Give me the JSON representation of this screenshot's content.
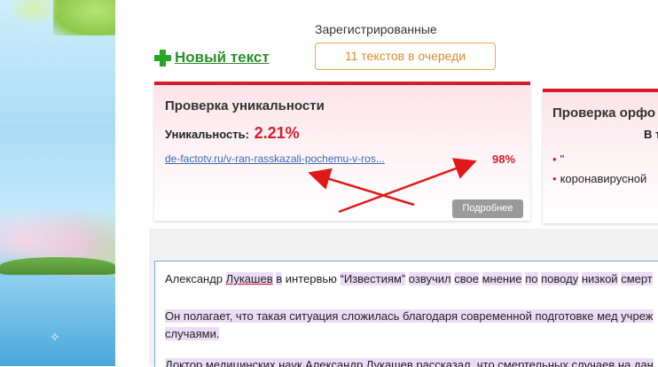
{
  "header": {
    "registered_label": "Зарегистрированные",
    "queue_button": "11 текстов в очереди",
    "new_text_link": "Новый текст"
  },
  "uniqueness": {
    "title": "Проверка уникальности",
    "label": "Уникальность:",
    "value": "2.21%",
    "source_link": "de-factotv.ru/v-ran-rasskazali-pochemu-v-ros...",
    "source_percent": "98%",
    "more_button": "Подробнее"
  },
  "spelling": {
    "title": "Проверка орфо",
    "subtitle": "В т",
    "items": [
      "\"",
      "коронавирусной"
    ]
  },
  "editor": {
    "p1": [
      "Александр ",
      "Лукашев",
      " ",
      "в",
      " интервью ",
      "“Известиям”",
      " ",
      "озвучил",
      " ",
      "свое",
      " ",
      "мнение",
      " ",
      "по",
      " ",
      "поводу",
      " ",
      "низкой",
      " ",
      "смерт"
    ],
    "p2": [
      "Он полагает, что такая ситуация сложилась благодаря современной подготовке мед учреж",
      "случаями."
    ],
    "p3": [
      "Доктор медицинских наук Александр Лукашев рассказал, что смертельных случаев на дан"
    ]
  },
  "colors": {
    "accent_red": "#d61c2c",
    "green": "#2a8f2a",
    "orange": "#e08a2a",
    "link_blue": "#3b6bb0"
  },
  "icons": {
    "new_text": "plus-icon"
  }
}
